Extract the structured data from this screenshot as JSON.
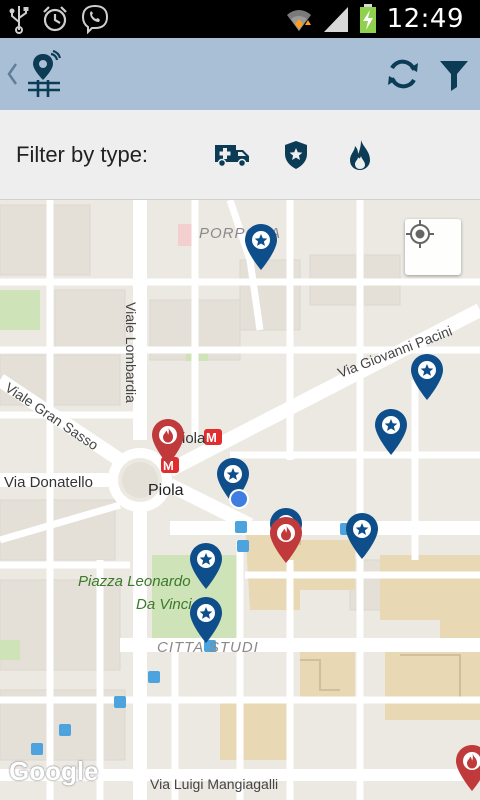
{
  "status_bar": {
    "time": "12:49",
    "left_icons": [
      "usb-icon",
      "alarm-icon",
      "viber-icon"
    ],
    "right_icons": [
      "wifi-icon",
      "signal-icon",
      "battery-charging-icon"
    ]
  },
  "action_bar": {
    "background": "#a9bfd6",
    "icon_color": "#0b3b55",
    "buttons": [
      "refresh-icon",
      "filter-icon"
    ]
  },
  "filter_bar": {
    "label": "Filter by type:",
    "types": [
      "ambulance-icon",
      "police-badge-icon",
      "fire-icon"
    ]
  },
  "map": {
    "labels": {
      "porpora": "PORPORA",
      "viale_lombardia": "Viale Lombardia",
      "via_giovanni_pacini": "Via Giovanni Pacini",
      "viale_gran_sasso": "Viale Gran Sasso",
      "piola_metro": "Piola",
      "via_donatello": "Via Donatello",
      "piola": "Piola",
      "piazza_1": "Piazza Leonardo",
      "piazza_2": "Da Vinci",
      "citta_studi": "CITTA STUDI",
      "via_luigi_mangiagalli": "Via Luigi Mangiagalli"
    },
    "attribution": "Google",
    "markers": [
      {
        "type": "police",
        "color": "#0e4f8b"
      },
      {
        "type": "police",
        "color": "#0e4f8b"
      },
      {
        "type": "police",
        "color": "#0e4f8b"
      },
      {
        "type": "fire",
        "color": "#c0393b"
      },
      {
        "type": "police",
        "color": "#0e4f8b"
      },
      {
        "type": "police",
        "color": "#0e4f8b"
      },
      {
        "type": "fire",
        "color": "#c0393b"
      },
      {
        "type": "police",
        "color": "#0e4f8b"
      },
      {
        "type": "police",
        "color": "#0e4f8b"
      },
      {
        "type": "police",
        "color": "#0e4f8b"
      },
      {
        "type": "fire",
        "color": "#c0393b"
      }
    ],
    "my_location_button": "crosshair-icon"
  }
}
